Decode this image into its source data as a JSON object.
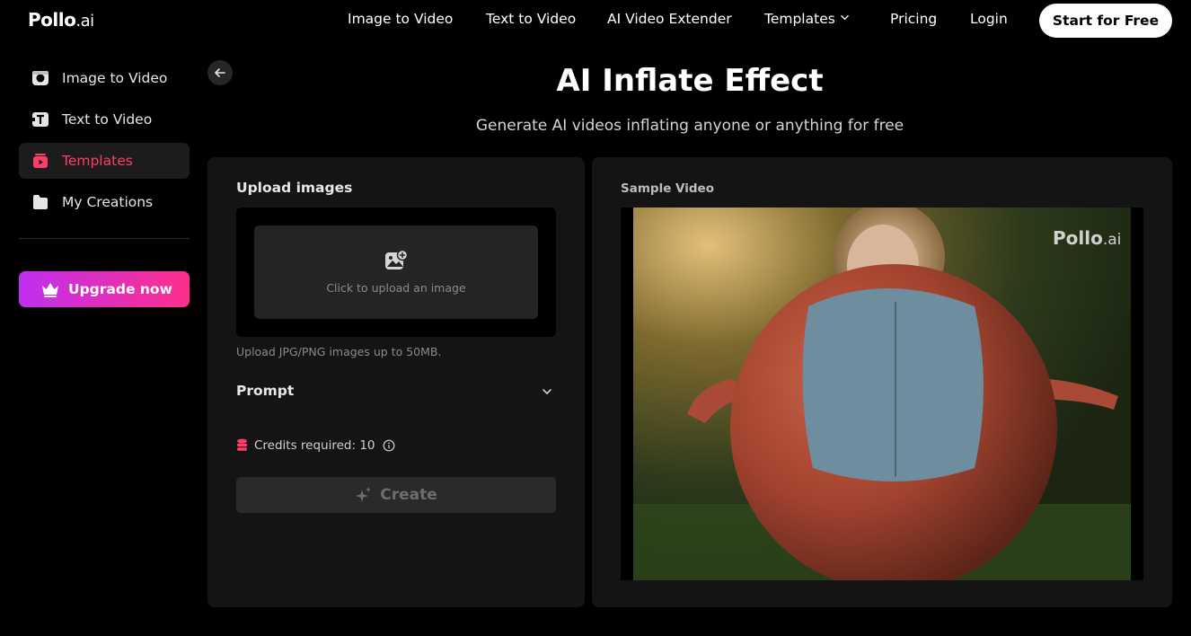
{
  "brand": {
    "name": "Pollo",
    "suffix": ".ai",
    "accent": "#ff3d68"
  },
  "nav": {
    "items": [
      {
        "label": "Image to Video"
      },
      {
        "label": "Text to Video"
      },
      {
        "label": "AI Video Extender"
      },
      {
        "label": "Templates",
        "has_dropdown": true
      },
      {
        "label": "Pricing"
      },
      {
        "label": "Login"
      }
    ],
    "cta_label": "Start for Free"
  },
  "sidebar": {
    "items": [
      {
        "label": "Image to Video",
        "icon": "image-to-video-icon",
        "active": false
      },
      {
        "label": "Text to Video",
        "icon": "text-to-video-icon",
        "active": false
      },
      {
        "label": "Templates",
        "icon": "templates-icon",
        "active": true
      },
      {
        "label": "My Creations",
        "icon": "folder-icon",
        "active": false
      }
    ],
    "upgrade_label": "Upgrade now",
    "upgrade_icon": "crown-icon"
  },
  "header": {
    "title": "AI Inflate Effect",
    "subtitle": "Generate AI videos inflating anyone or anything for free"
  },
  "form": {
    "upload_label": "Upload images",
    "upload_placeholder": "Click to upload an image",
    "upload_hint": "Upload JPG/PNG images up to 50MB.",
    "prompt_label": "Prompt",
    "credits_text": "Credits required: 10",
    "create_label": "Create"
  },
  "sample": {
    "label": "Sample Video",
    "watermark_name": "Pollo",
    "watermark_suffix": ".ai"
  }
}
